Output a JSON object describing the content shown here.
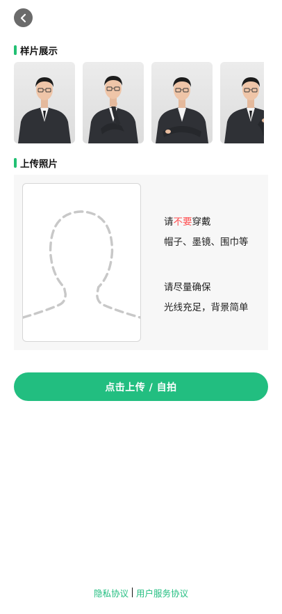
{
  "nav": {
    "back_icon": "chevron-left-icon"
  },
  "samples": {
    "title": "样片展示",
    "items": [
      {
        "name": "sample-front"
      },
      {
        "name": "sample-chin"
      },
      {
        "name": "sample-arms-crossed"
      },
      {
        "name": "sample-cufflink"
      }
    ]
  },
  "upload": {
    "title": "上传照片",
    "placeholder_icon": "person-silhouette-icon",
    "tip1": {
      "prefix": "请",
      "highlight": "不要",
      "suffix": "穿戴",
      "detail": "帽子、墨镜、围巾等"
    },
    "tip2": {
      "line1": "请尽量确保",
      "line2": "光线充足，背景简单"
    },
    "button_label": "点击上传 / 自拍"
  },
  "footer": {
    "privacy": "隐私协议",
    "service": "用户服务协议"
  },
  "colors": {
    "accent": "#22be80",
    "warning": "#ff4d4f",
    "panel": "#f7f7f7"
  }
}
